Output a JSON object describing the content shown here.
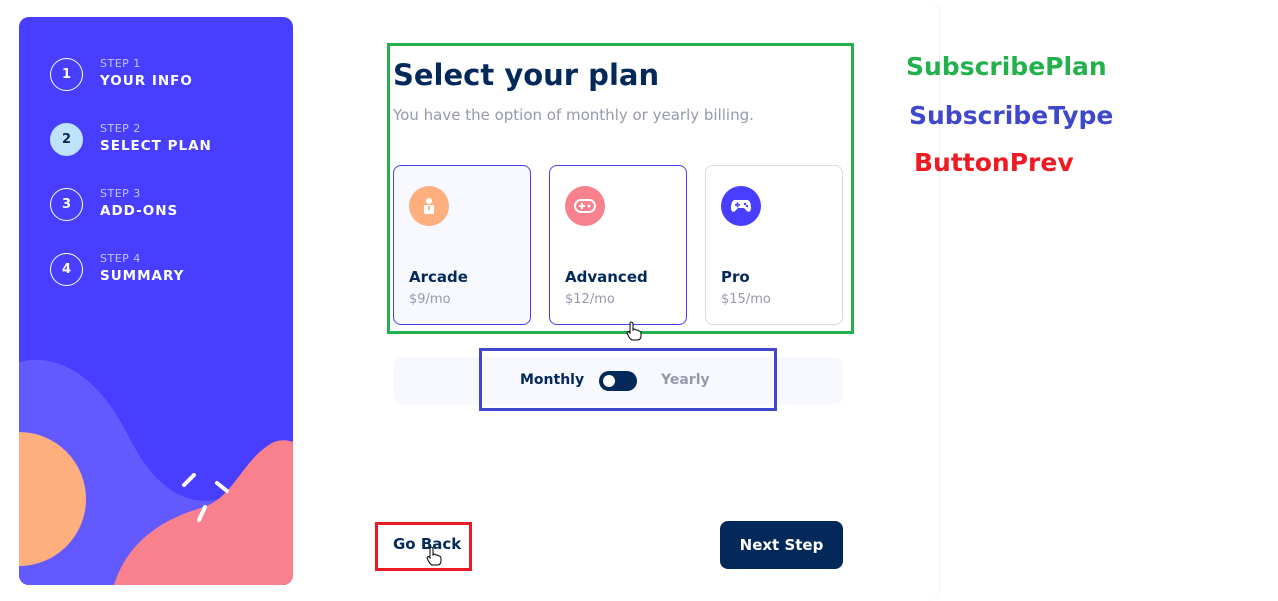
{
  "sidebar": {
    "steps": [
      {
        "number": "1",
        "sub": "STEP 1",
        "title": "YOUR INFO",
        "active": false
      },
      {
        "number": "2",
        "sub": "STEP 2",
        "title": "SELECT PLAN",
        "active": true
      },
      {
        "number": "3",
        "sub": "STEP 3",
        "title": "ADD-ONS",
        "active": false
      },
      {
        "number": "4",
        "sub": "STEP 4",
        "title": "SUMMARY",
        "active": false
      }
    ]
  },
  "main": {
    "title": "Select your plan",
    "subtitle": "You have the option of monthly or yearly billing."
  },
  "plans": [
    {
      "name": "Arcade",
      "price": "$9/mo",
      "icon": "arcade-icon",
      "color": "#ffaf7e",
      "selected": true
    },
    {
      "name": "Advanced",
      "price": "$12/mo",
      "icon": "gamepad-icon",
      "color": "#f9818e",
      "selected": false
    },
    {
      "name": "Pro",
      "price": "$15/mo",
      "icon": "controller-icon",
      "color": "#483eff",
      "selected": false
    }
  ],
  "billing": {
    "monthly_label": "Monthly",
    "yearly_label": "Yearly",
    "toggle_state": "monthly"
  },
  "buttons": {
    "back": "Go Back",
    "next": "Next Step"
  },
  "annotations": {
    "subscribe_plan": {
      "label": "SubscribePlan",
      "color": "#22b14c"
    },
    "subscribe_type": {
      "label": "SubscribeType",
      "color": "#3f48cc"
    },
    "button_prev": {
      "label": "ButtonPrev",
      "color": "#ed1c24"
    }
  },
  "colors": {
    "sidebar": "#483eff",
    "primary": "#02295a",
    "muted": "#9699ab",
    "active_step": "#bfe2fd"
  }
}
